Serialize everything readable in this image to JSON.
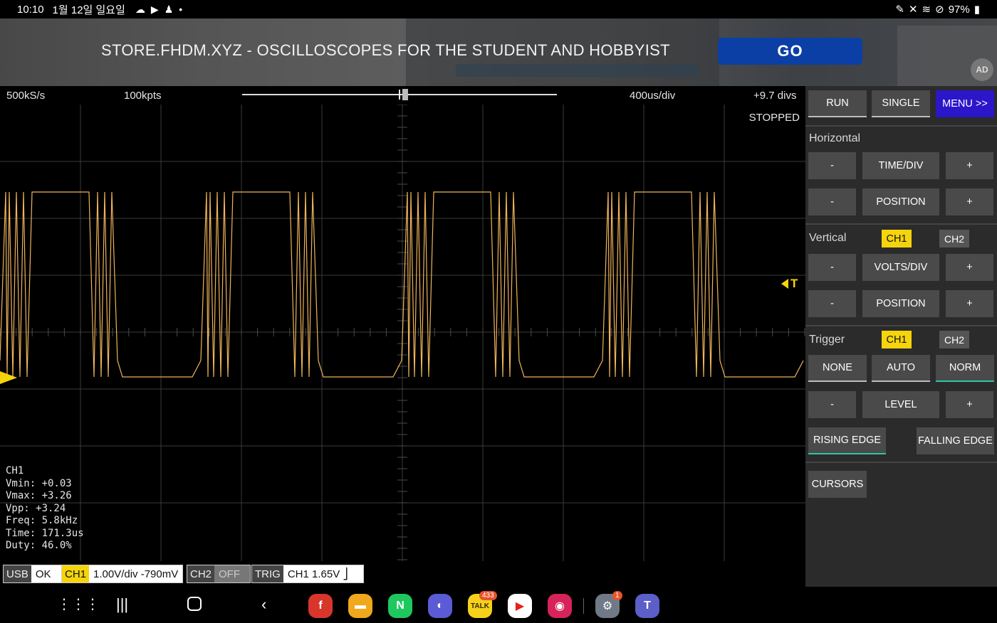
{
  "status_bar": {
    "time": "10:10",
    "date": "1월 12일 일요일",
    "battery": "97%"
  },
  "ad": {
    "headline": "STORE.FHDM.XYZ - OSCILLOSCOPES FOR THE STUDENT AND HOBBYIST",
    "button_label": "GO",
    "badge": "AD"
  },
  "scope": {
    "sample_rate": "500kS/s",
    "points": "100kpts",
    "time_per_div": "400us/div",
    "offset": "+9.7 divs",
    "state": "STOPPED",
    "trigger_marker": "T",
    "timeline_position": 0.52,
    "measurements": {
      "channel": "CH1",
      "vmin": "Vmin: +0.03",
      "vmax": "Vmax: +3.26",
      "vpp": "Vpp: +3.24",
      "freq": "Freq: 5.8kHz",
      "time": "Time: 171.3us",
      "duty": "Duty: 46.0%"
    },
    "status": {
      "usb_tag": "USB",
      "usb_val": "OK",
      "ch1_tag": "CH1",
      "ch1_val": "1.00V/div  -790mV",
      "ch2_tag": "CH2",
      "ch2_val": "OFF",
      "trig_tag": "TRIG",
      "trig_val": "CH1  1.65V  ⎦"
    },
    "trace_color": "#f0b45a",
    "accent_yellow": "#f5d40c"
  },
  "panel": {
    "run": "RUN",
    "single": "SINGLE",
    "menu": "MENU >>",
    "horizontal_label": "Horizontal",
    "minus": "-",
    "plus": "+",
    "time_div": "TIME/DIV",
    "position": "POSITION",
    "vertical_label": "Vertical",
    "ch1": "CH1",
    "ch2": "CH2",
    "volts_div": "VOLTS/DIV",
    "trigger_label": "Trigger",
    "none": "NONE",
    "auto": "AUTO",
    "norm": "NORM",
    "level": "LEVEL",
    "rising_edge": "RISING EDGE",
    "falling_edge": "FALLING EDGE",
    "cursors": "CURSORS"
  },
  "navbar": {
    "apps": [
      "flipboard-app",
      "files-app",
      "naver-app",
      "internet-app",
      "kakaotalk-app",
      "youtube-app",
      "camera-app",
      "settings-app",
      "teams-app"
    ],
    "kakao_badge": "433",
    "settings_badge": "1"
  }
}
